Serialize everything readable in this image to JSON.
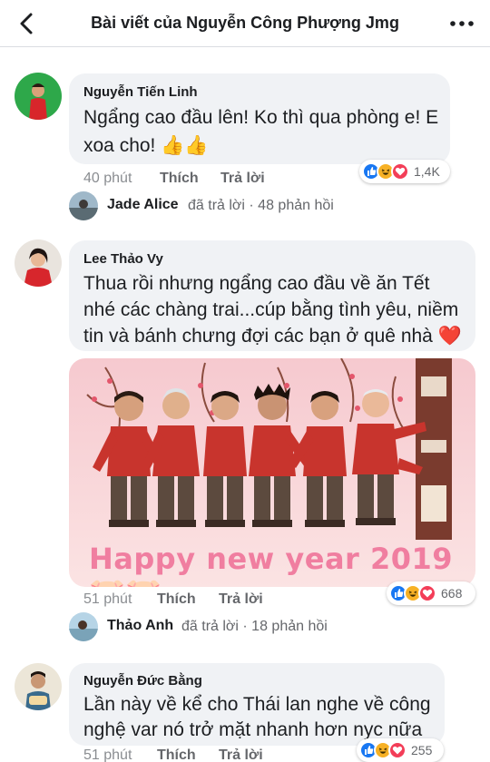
{
  "header": {
    "title": "Bài viết của Nguyễn Công Phượng Jmg"
  },
  "comments": [
    {
      "author": "Nguyễn Tiến Linh",
      "text_lines": [
        "Ngẩng cao đầu lên! Ko thì qua phòng e! E",
        "xoa cho! 👍👍"
      ],
      "time": "40 phút",
      "like_label": "Thích",
      "reply_label": "Trả lời",
      "reaction_count": "1,4K",
      "reply": {
        "name": "Jade Alice",
        "text": "đã trả lời · 48 phản hồi"
      }
    },
    {
      "author": "Lee Thảo Vy",
      "text_lines": [
        "Thua rồi nhưng ngẩng cao đầu về ăn Tết",
        "nhé các chàng trai...cúp bằng tình yêu, niềm",
        "tin và bánh chưng đợi các bạn ở quê nhà ❤️"
      ],
      "photo_caption": "Happy new year 2019 🐷🐷",
      "time": "51 phút",
      "like_label": "Thích",
      "reply_label": "Trả lời",
      "reaction_count": "668",
      "reply": {
        "name": "Thảo Anh",
        "text": "đã trả lời · 18 phản hồi"
      }
    },
    {
      "author": "Nguyễn Đức Bằng",
      "text_lines": [
        "Lần này về kể cho Thái lan nghe về công",
        "nghệ var nó trở mặt nhanh hơn nyc nữa"
      ],
      "time": "51 phút",
      "like_label": "Thích",
      "reply_label": "Trả lời",
      "reaction_count": "255"
    }
  ],
  "icons": {
    "back": "chevron-left-icon",
    "more": "more-horizontal-icon",
    "reactions": [
      "like-reaction-icon",
      "haha-reaction-icon",
      "love-reaction-icon"
    ]
  },
  "colors": {
    "like": "#1877f2",
    "haha": "#f7b125",
    "love": "#f33e58",
    "bubble": "#f0f2f5"
  }
}
